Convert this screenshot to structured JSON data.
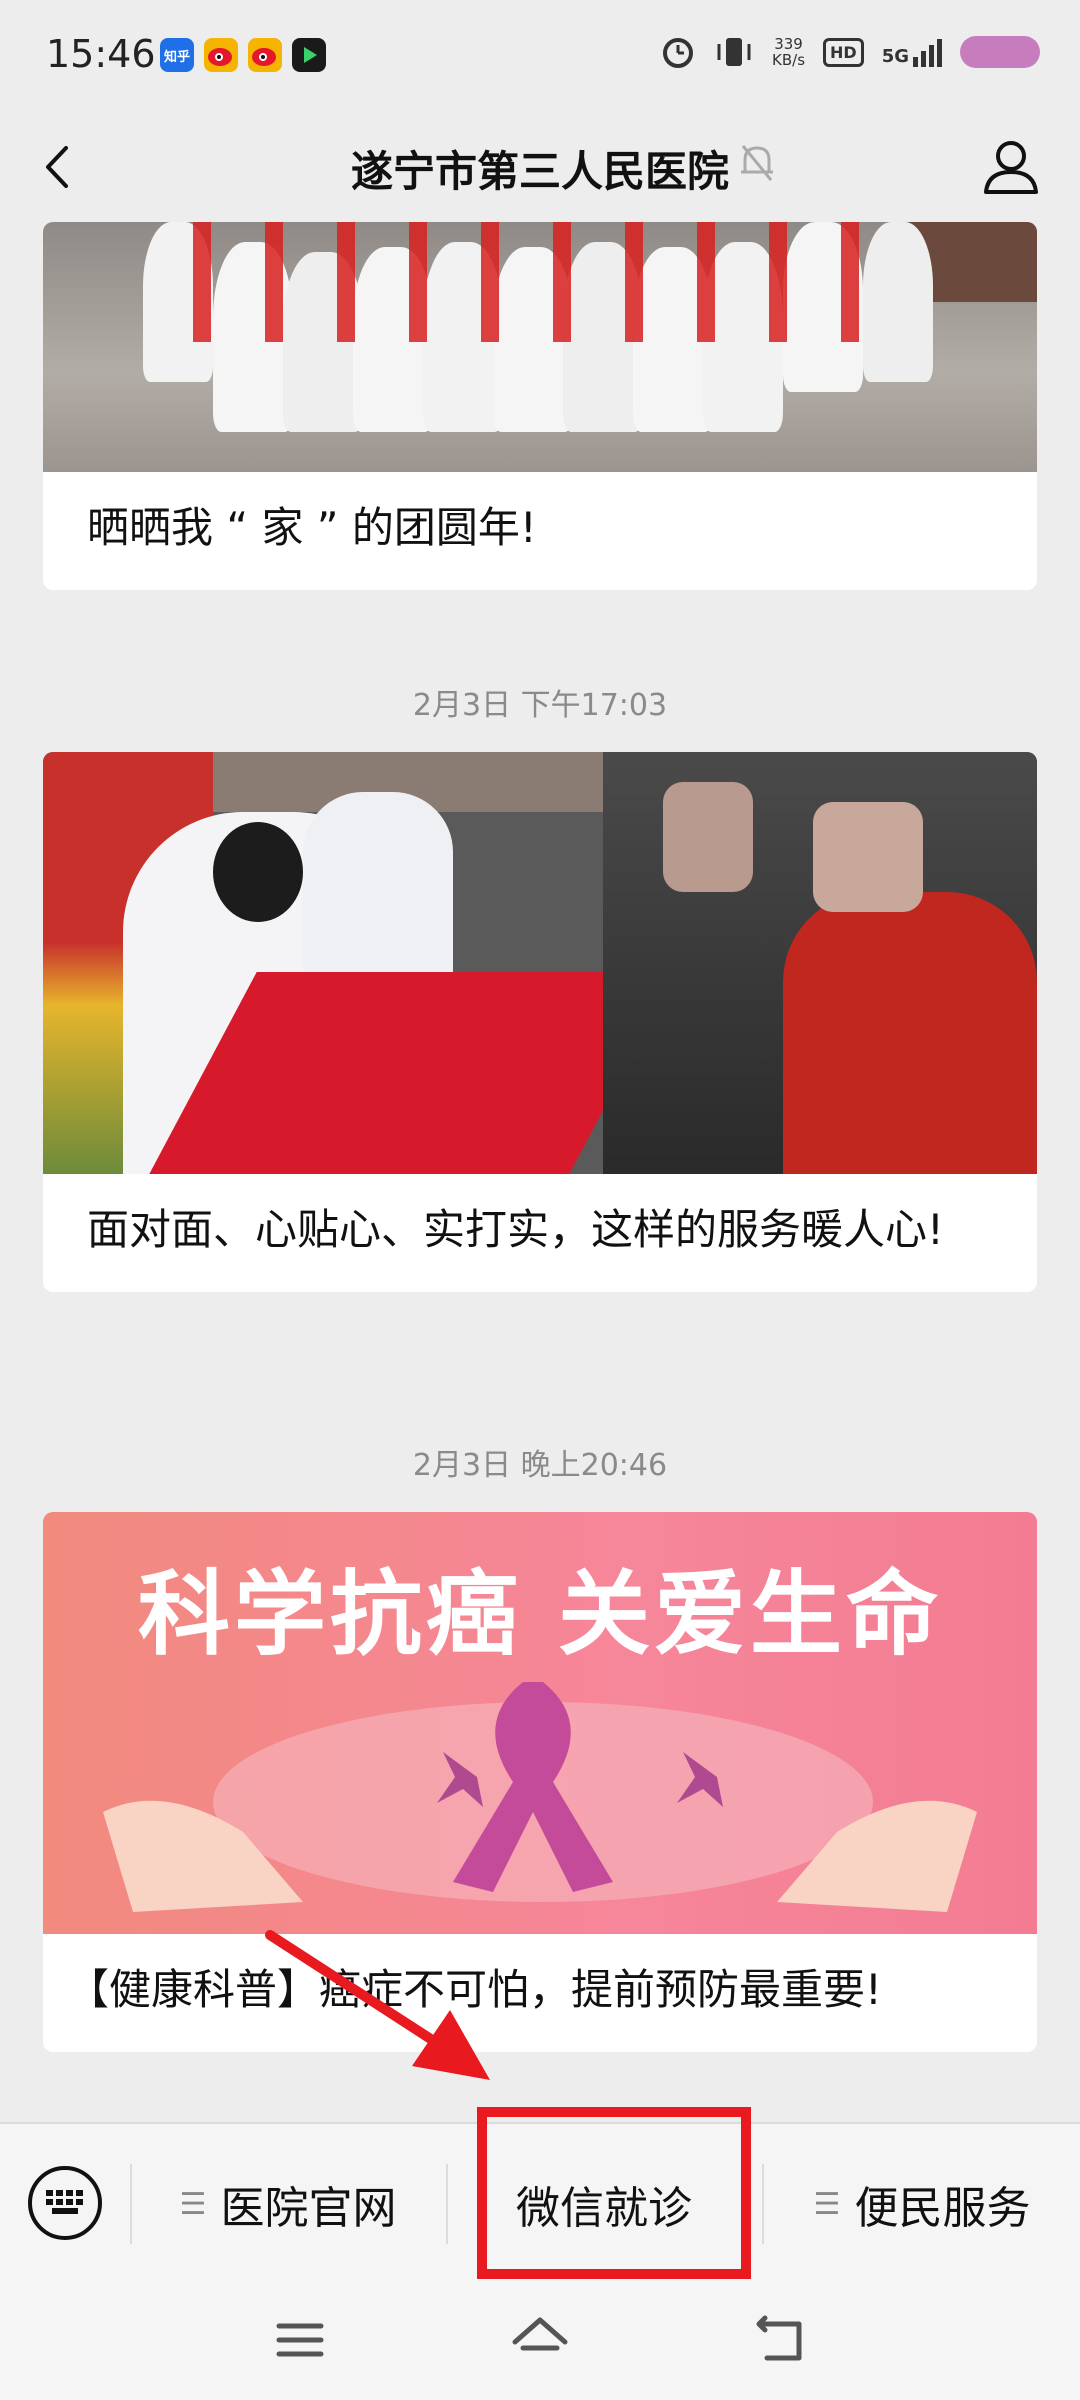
{
  "status_bar": {
    "time": "15:46",
    "app_icons": [
      "知乎",
      "weibo",
      "weibo",
      "video"
    ],
    "net_speed_value": "339",
    "net_speed_unit": "KB/s",
    "hd_label": "HD",
    "network_label": "5G"
  },
  "header": {
    "title": "遂宁市第三人民医院"
  },
  "feed": {
    "posts": [
      {
        "title": "晒晒我 “ 家 ” 的团圆年!"
      },
      {
        "timestamp": "2月3日 下午17:03",
        "title": "面对面、心贴心、实打实，这样的服务暖人心!"
      },
      {
        "timestamp": "2月3日 晚上20:46",
        "poster_text": "科学抗癌  关爱生命",
        "title": "【健康科普】癌症不可怕，提前预防最重要!"
      }
    ]
  },
  "bottom_menu": {
    "items": [
      {
        "label": "医院官网",
        "has_submenu": true
      },
      {
        "label": "微信就诊",
        "has_submenu": false
      },
      {
        "label": "便民服务",
        "has_submenu": true
      }
    ]
  },
  "colors": {
    "background": "#ededed",
    "annotation_red": "#e8191f",
    "battery": "#c77dbd"
  }
}
